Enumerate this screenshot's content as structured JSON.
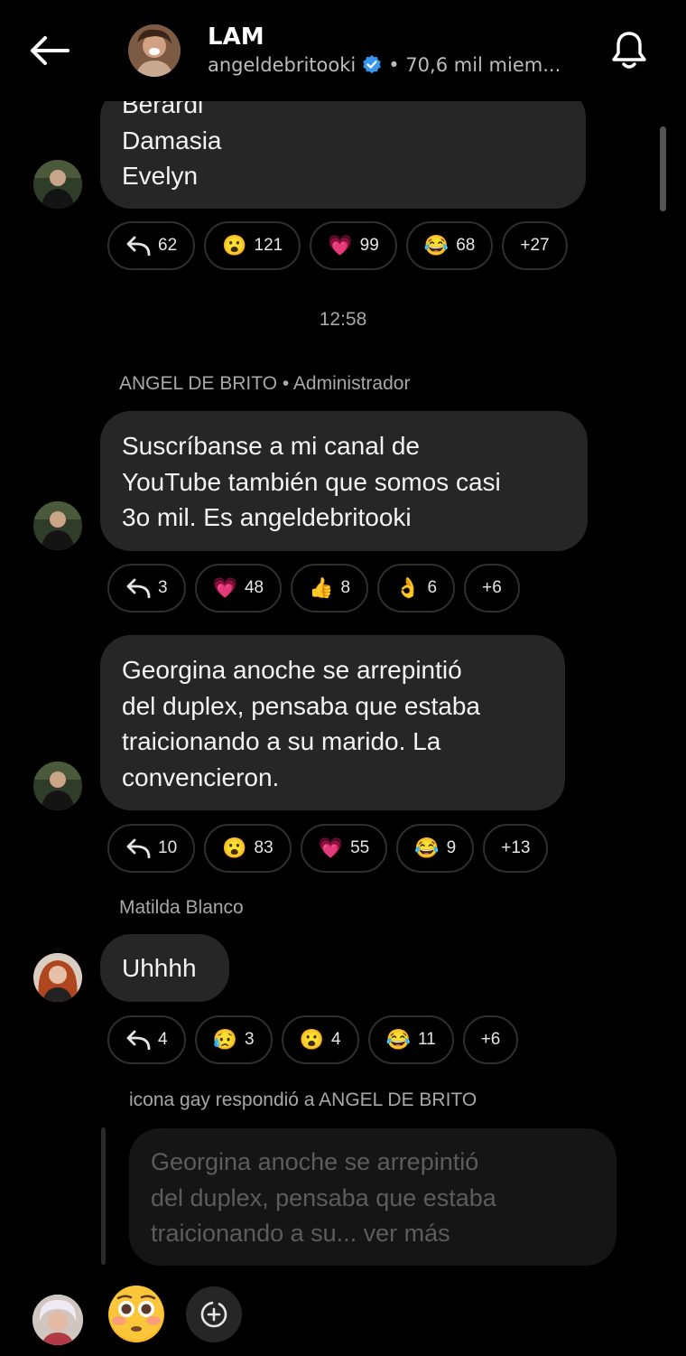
{
  "header": {
    "title": "LAM",
    "handle": "angeldebritooki",
    "members": "• 70,6 mil miem..."
  },
  "messages": [
    {
      "id": "m1",
      "lines": [
        "Berardi",
        "Damasia",
        "Evelyn"
      ],
      "reactions": [
        {
          "icon": "reply-icon",
          "count": "62"
        },
        {
          "icon": "astonished-emoji",
          "emoji": "😮",
          "count": "121"
        },
        {
          "icon": "heart-emoji",
          "emoji": "💗",
          "count": "99"
        },
        {
          "icon": "laughing-emoji",
          "emoji": "😂",
          "count": "68"
        },
        {
          "label": "+27"
        }
      ]
    },
    {
      "id": "m2",
      "sender": "ANGEL DE BRITO • Administrador",
      "lines": [
        "Suscríbanse a mi canal de",
        "YouTube también que somos casi",
        "3o mil. Es angeldebritooki"
      ],
      "reactions": [
        {
          "icon": "reply-icon",
          "count": "3"
        },
        {
          "icon": "heart-emoji",
          "emoji": "💗",
          "count": "48"
        },
        {
          "icon": "thumbs-up-emoji",
          "emoji": "👍",
          "count": "8"
        },
        {
          "icon": "ok-hand-emoji",
          "emoji": "👌",
          "count": "6"
        },
        {
          "label": "+6"
        }
      ]
    },
    {
      "id": "m3",
      "lines": [
        "Georgina anoche se arrepintió",
        "del duplex, pensaba que estaba",
        "traicionando a su marido. La",
        "convencieron."
      ],
      "reactions": [
        {
          "icon": "reply-icon",
          "count": "10"
        },
        {
          "icon": "astonished-emoji",
          "emoji": "😮",
          "count": "83"
        },
        {
          "icon": "heart-emoji",
          "emoji": "💗",
          "count": "55"
        },
        {
          "icon": "laughing-emoji",
          "emoji": "😂",
          "count": "9"
        },
        {
          "label": "+13"
        }
      ]
    },
    {
      "id": "m4",
      "sender": "Matilda Blanco",
      "lines": [
        "Uhhhh"
      ],
      "reactions": [
        {
          "icon": "reply-icon",
          "count": "4"
        },
        {
          "icon": "sad-relieved-emoji",
          "emoji": "😥",
          "count": "3"
        },
        {
          "icon": "astonished-emoji",
          "emoji": "😮",
          "count": "4"
        },
        {
          "icon": "laughing-emoji",
          "emoji": "😂",
          "count": "11"
        },
        {
          "label": "+6"
        }
      ]
    }
  ],
  "timestamp": "12:58",
  "reply": {
    "label": "icona gay respondió a ANGEL DE BRITO",
    "lines": [
      "Georgina anoche se arrepintió",
      "del duplex, pensaba que estaba",
      "traicionando a su... ver más"
    ]
  },
  "bottom": {
    "reaction_emoji": "😳"
  },
  "colors": {
    "background": "#000000",
    "bubble": "#262626",
    "verified": "#3797f0",
    "muted_text": "#a8a8a8"
  }
}
